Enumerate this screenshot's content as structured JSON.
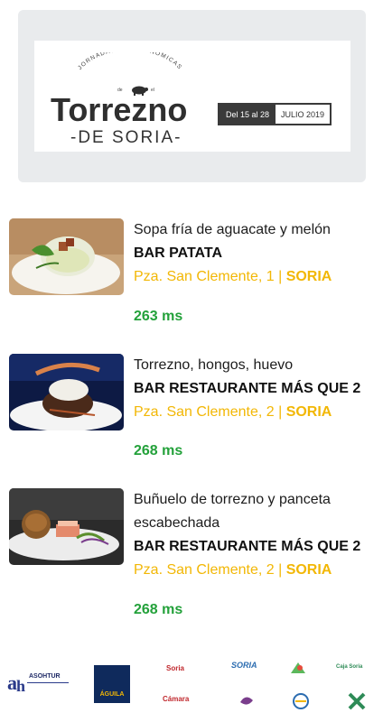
{
  "banner": {
    "jornadas": "JORNADAS GASTRONÓMICAS",
    "de": "de",
    "el": "el",
    "title": "Torrezno",
    "subtitle": "-DE SORIA-",
    "dates_left": "Del 15 al 28",
    "dates_right": "JULIO 2019"
  },
  "items": [
    {
      "dish": "Sopa fría de aguacate y melón",
      "bar": "BAR PATATA",
      "address": "Pza. San Clemente, 1 | ",
      "city": "SORIA",
      "timing": "263 ms"
    },
    {
      "dish": "Torrezno, hongos, huevo",
      "bar": "BAR RESTAURANTE MÁS QUE 2",
      "address": "Pza. San Clemente, 2 | ",
      "city": "SORIA",
      "timing": "268 ms"
    },
    {
      "dish": "Buñuelo de torrezno y panceta escabechada",
      "bar": "BAR RESTAURANTE MÁS QUE 2",
      "address": "Pza. San Clemente, 2 | ",
      "city": "SORIA",
      "timing": "268 ms"
    }
  ],
  "sponsors": {
    "asohtur": "ASOHTUR",
    "aguila": "ÁGUILA",
    "ayto_soria": "Soria",
    "soria_ni": "SORIA",
    "caja_rural": "Caja Soria",
    "camara": "Cámara",
    "diputacion": "Diputación de Soria"
  },
  "colors": {
    "accent_yellow": "#f2b705",
    "timing_green": "#23a13a",
    "banner_bg": "#e9ebed"
  }
}
